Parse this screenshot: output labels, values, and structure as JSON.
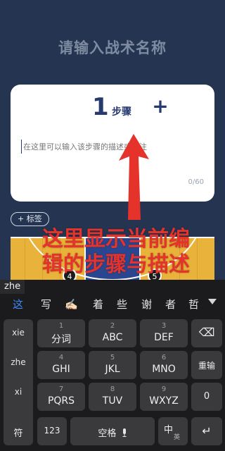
{
  "page": {
    "title": "请输入战术名称"
  },
  "step_card": {
    "number": "1",
    "label": "步骤",
    "add": "+",
    "placeholder": "在这里可以输入该步骤的描述或备注",
    "counter": "0/60"
  },
  "tag_button": "+ 标签",
  "court": {
    "players": [
      "4",
      "5"
    ]
  },
  "annotation": {
    "lines": [
      "这里显示当前编",
      "辑的步骤与描述"
    ],
    "color": "#e5322b"
  },
  "keyboard": {
    "composing": "zhe",
    "candidates": [
      "这",
      "写",
      "✍🏻",
      "着",
      "些",
      "谢",
      "者",
      "哲"
    ],
    "left_column": [
      "xie",
      "zhe",
      "xi",
      "yi"
    ],
    "keys": [
      {
        "num": "1",
        "label": "分词"
      },
      {
        "num": "2",
        "label": "ABC"
      },
      {
        "num": "3",
        "label": "DEF"
      },
      {
        "num": "4",
        "label": "GHI"
      },
      {
        "num": "5",
        "label": "JKL"
      },
      {
        "num": "6",
        "label": "MNO"
      },
      {
        "num": "7",
        "label": "PQRS"
      },
      {
        "num": "8",
        "label": "TUV"
      },
      {
        "num": "9",
        "label": "WXYZ"
      }
    ],
    "backspace": "⌫",
    "reenter": "重输",
    "zero": "0",
    "symbol": "符",
    "num123": "123",
    "space": "空格",
    "lang_main": "中",
    "lang_sub": "英",
    "enter": "↵"
  }
}
